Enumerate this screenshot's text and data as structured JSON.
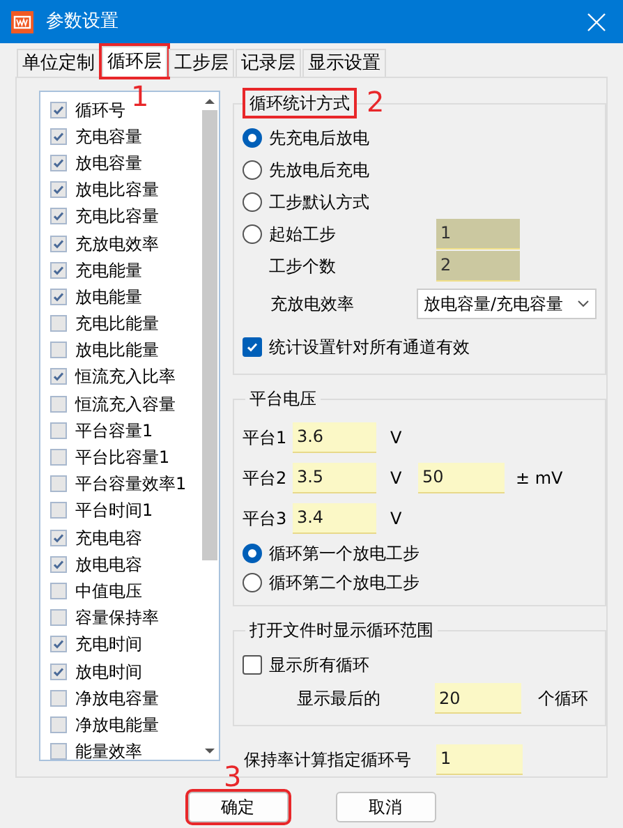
{
  "window": {
    "title": "参数设置"
  },
  "tabs": [
    {
      "label": "单位定制",
      "selected": false
    },
    {
      "label": "循环层",
      "selected": true,
      "callout": "1"
    },
    {
      "label": "工步层",
      "selected": false
    },
    {
      "label": "记录层",
      "selected": false
    },
    {
      "label": "显示设置",
      "selected": false
    }
  ],
  "columns_list": {
    "items": [
      {
        "label": "循环号",
        "checked": true
      },
      {
        "label": "充电容量",
        "checked": true
      },
      {
        "label": "放电容量",
        "checked": true
      },
      {
        "label": "放电比容量",
        "checked": true
      },
      {
        "label": "充电比容量",
        "checked": true
      },
      {
        "label": "充放电效率",
        "checked": true
      },
      {
        "label": "充电能量",
        "checked": true
      },
      {
        "label": "放电能量",
        "checked": true
      },
      {
        "label": "充电比能量",
        "checked": false
      },
      {
        "label": "放电比能量",
        "checked": false
      },
      {
        "label": "恒流充入比率",
        "checked": true
      },
      {
        "label": "恒流充入容量",
        "checked": false
      },
      {
        "label": "平台容量1",
        "checked": false
      },
      {
        "label": "平台比容量1",
        "checked": false
      },
      {
        "label": "平台容量效率1",
        "checked": false
      },
      {
        "label": "平台时间1",
        "checked": false
      },
      {
        "label": "充电电容",
        "checked": true
      },
      {
        "label": "放电电容",
        "checked": true
      },
      {
        "label": "中值电压",
        "checked": false
      },
      {
        "label": "容量保持率",
        "checked": false
      },
      {
        "label": "充电时间",
        "checked": true
      },
      {
        "label": "放电时间",
        "checked": true
      },
      {
        "label": "净放电容量",
        "checked": false
      },
      {
        "label": "净放电能量",
        "checked": false
      },
      {
        "label": "能量效率",
        "checked": false
      }
    ]
  },
  "cycle_stat": {
    "title": "循环统计方式",
    "callout": "2",
    "modes": [
      {
        "label": "先充电后放电",
        "selected": true
      },
      {
        "label": "先放电后充电",
        "selected": false
      },
      {
        "label": "工步默认方式",
        "selected": false
      },
      {
        "label": "起始工步",
        "selected": false,
        "field": {
          "value": "1",
          "disabled": true
        }
      }
    ],
    "step_count": {
      "label": "工步个数",
      "value": "2",
      "disabled": true
    },
    "efficiency": {
      "label": "充放电效率",
      "value": "放电容量/充电容量"
    },
    "apply_all": {
      "label": "统计设置针对所有通道有效",
      "checked": true
    }
  },
  "plateau_voltage": {
    "title": "平台电压",
    "rows": [
      {
        "label": "平台1",
        "value": "3.6",
        "unit": "V"
      },
      {
        "label": "平台2",
        "value": "3.5",
        "unit": "V",
        "tolerance": "50",
        "tolerance_unit": "± mV"
      },
      {
        "label": "平台3",
        "value": "3.4",
        "unit": "V"
      }
    ],
    "options": [
      {
        "label": "循环第一个放电工步",
        "selected": true
      },
      {
        "label": "循环第二个放电工步",
        "selected": false
      }
    ]
  },
  "open_range": {
    "title": "打开文件时显示循环范围",
    "show_all": {
      "label": "显示所有循环",
      "checked": false
    },
    "last_label": "显示最后的",
    "last_value": "20",
    "last_unit": "个循环"
  },
  "retention": {
    "label": "保持率计算指定循环号",
    "value": "1"
  },
  "buttons": [
    {
      "label": "确定",
      "callout": "3"
    },
    {
      "label": "取消"
    }
  ]
}
